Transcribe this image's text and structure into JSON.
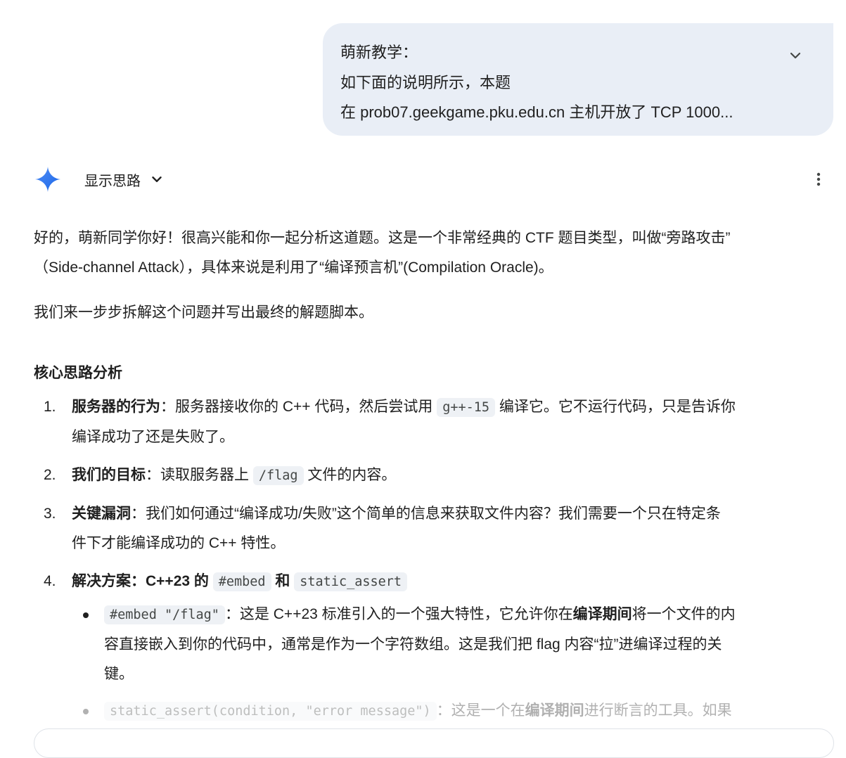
{
  "user_message": {
    "line1": "萌新教学：",
    "line2": "如下面的说明所示，本题",
    "line3": "在 prob07.geekgame.pku.edu.cn 主机开放了 TCP 1000..."
  },
  "model": {
    "show_thinking_label": "显示思路"
  },
  "response": {
    "para1_line1": "好的，萌新同学你好！很高兴能和你一起分析这道题。这是一个非常经典的 CTF 题目类型，叫做“旁路攻击”",
    "para1_line2": "（Side-channel Attack），具体来说是利用了“编译预言机”(Compilation Oracle)。",
    "para2": "我们来一步步拆解这个问题并写出最终的解题脚本。",
    "heading": "核心思路分析",
    "items": [
      {
        "num": "1.",
        "bold": "服务器的行为",
        "text_a": "：服务器接收你的 C++ 代码，然后尝试用",
        "code": "g++-15",
        "text_b": "编译它。它不运行代码，只是告诉你",
        "text_c": "编译成功了还是失败了。"
      },
      {
        "num": "2.",
        "bold": "我们的目标",
        "text_a": "：读取服务器上",
        "code": "/flag",
        "text_b": "文件的内容。"
      },
      {
        "num": "3.",
        "bold": "关键漏洞",
        "text_a": "：我们如何通过“编译成功/失败”这个简单的信息来获取文件内容？我们需要一个只在特定条",
        "text_b": "件下才能编译成功的 C++ 特性。"
      },
      {
        "num": "4.",
        "bold_a": "解决方案：C++23 的",
        "code_a": "#embed",
        "bold_b": "和",
        "code_b": "static_assert"
      }
    ],
    "bullets": [
      {
        "code": "#embed \"/flag\"",
        "text_a": "：这是 C++23 标准引入的一个强大特性，它允许你在",
        "bold": "编译期间",
        "text_b": "将一个文件的内",
        "text_c": "容直接嵌入到你的代码中，通常是作为一个字符数组。这是我们把 flag 内容“拉”进编译过程的关",
        "text_d": "键。"
      },
      {
        "code": "static_assert(condition, \"error message\")",
        "text_a": "：这是一个在",
        "bold": "编译期间",
        "text_b": "进行断言的工具。如果"
      }
    ]
  }
}
